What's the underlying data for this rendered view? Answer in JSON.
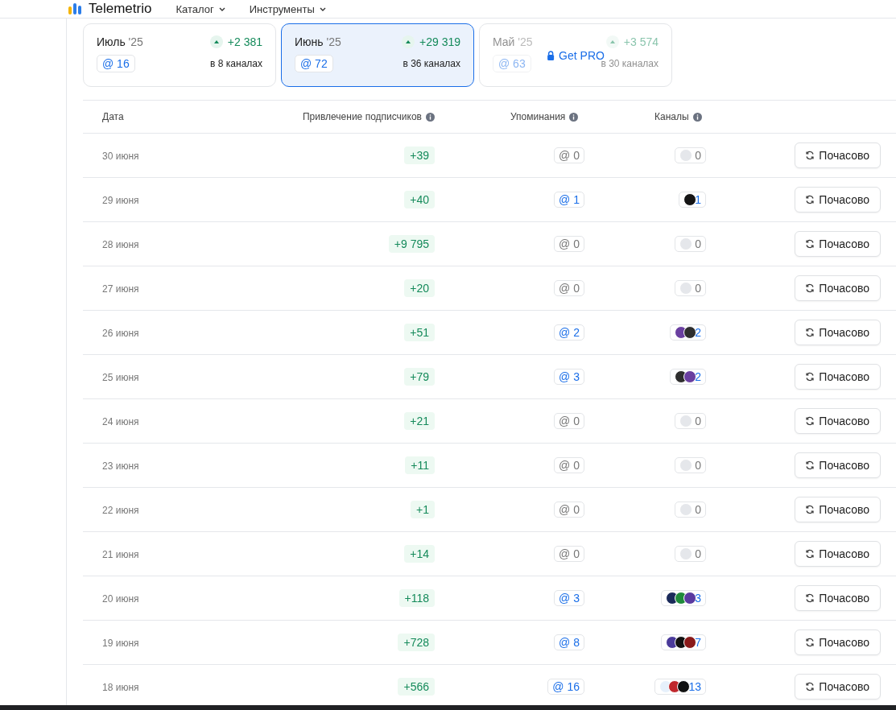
{
  "header": {
    "logo": "Telemetrio",
    "menu": [
      {
        "label": "Каталог"
      },
      {
        "label": "Инструменты"
      }
    ]
  },
  "months": [
    {
      "month": "Июль",
      "year": "'25",
      "growth": "+2 381",
      "mentions": "@ 16",
      "channels": "в 8 каналах",
      "selected": false,
      "locked": false
    },
    {
      "month": "Июнь",
      "year": "'25",
      "growth": "+29 319",
      "mentions": "@ 72",
      "channels": "в 36 каналах",
      "selected": true,
      "locked": false
    },
    {
      "month": "Май",
      "year": "'25",
      "growth": "+3 574",
      "mentions": "@ 63",
      "channels": "в 30 каналах",
      "selected": false,
      "locked": true,
      "lock_label": "Get PRO"
    }
  ],
  "table": {
    "columns": [
      {
        "label": "Дата",
        "info": false
      },
      {
        "label": "Привлечение подписчиков",
        "info": true
      },
      {
        "label": "Упоминания",
        "info": true
      },
      {
        "label": "Каналы",
        "info": true
      }
    ],
    "rows": [
      {
        "date": "30 июня",
        "growth": "+39",
        "mentions": "@ 0",
        "channels": "0",
        "muted": true,
        "avatars": [],
        "action": "Почасово"
      },
      {
        "date": "29 июня",
        "growth": "+40",
        "mentions": "@ 1",
        "channels": "1",
        "muted": false,
        "avatars": [
          {
            "color": "#151515"
          }
        ],
        "action": "Почасово"
      },
      {
        "date": "28 июня",
        "growth": "+9 795",
        "mentions": "@ 0",
        "channels": "0",
        "muted": true,
        "avatars": [],
        "action": "Почасово"
      },
      {
        "date": "27 июня",
        "growth": "+20",
        "mentions": "@ 0",
        "channels": "0",
        "muted": true,
        "avatars": [],
        "action": "Почасово"
      },
      {
        "date": "26 июня",
        "growth": "+51",
        "mentions": "@ 2",
        "channels": "2",
        "muted": false,
        "avatars": [
          {
            "color": "#6a3fa0"
          },
          {
            "color": "#2e2e2e"
          }
        ],
        "action": "Почасово"
      },
      {
        "date": "25 июня",
        "growth": "+79",
        "mentions": "@ 3",
        "channels": "2",
        "muted": false,
        "avatars": [
          {
            "color": "#2e2e2e"
          },
          {
            "color": "#6a3fa0"
          }
        ],
        "action": "Почасово"
      },
      {
        "date": "24 июня",
        "growth": "+21",
        "mentions": "@ 0",
        "channels": "0",
        "muted": true,
        "avatars": [],
        "action": "Почасово"
      },
      {
        "date": "23 июня",
        "growth": "+11",
        "mentions": "@ 0",
        "channels": "0",
        "muted": true,
        "avatars": [],
        "action": "Почасово"
      },
      {
        "date": "22 июня",
        "growth": "+1",
        "mentions": "@ 0",
        "channels": "0",
        "muted": true,
        "avatars": [],
        "action": "Почасово"
      },
      {
        "date": "21 июня",
        "growth": "+14",
        "mentions": "@ 0",
        "channels": "0",
        "muted": true,
        "avatars": [],
        "action": "Почасово"
      },
      {
        "date": "20 июня",
        "growth": "+118",
        "mentions": "@ 3",
        "channels": "3",
        "muted": false,
        "avatars": [
          {
            "color": "#1a2a5a"
          },
          {
            "color": "#1f8a3a"
          },
          {
            "color": "#5a3aa0"
          }
        ],
        "action": "Почасово"
      },
      {
        "date": "19 июня",
        "growth": "+728",
        "mentions": "@ 8",
        "channels": "7",
        "muted": false,
        "avatars": [
          {
            "color": "#4a3a9a"
          },
          {
            "color": "#111111"
          },
          {
            "color": "#8a1a1a"
          }
        ],
        "action": "Почасово"
      },
      {
        "date": "18 июня",
        "growth": "+566",
        "mentions": "@ 16",
        "channels": "13",
        "muted": false,
        "avatars": [
          {
            "color": "#e6f0fb"
          },
          {
            "color": "#c0282d"
          },
          {
            "color": "#111111"
          }
        ],
        "action": "Почасово"
      }
    ]
  }
}
